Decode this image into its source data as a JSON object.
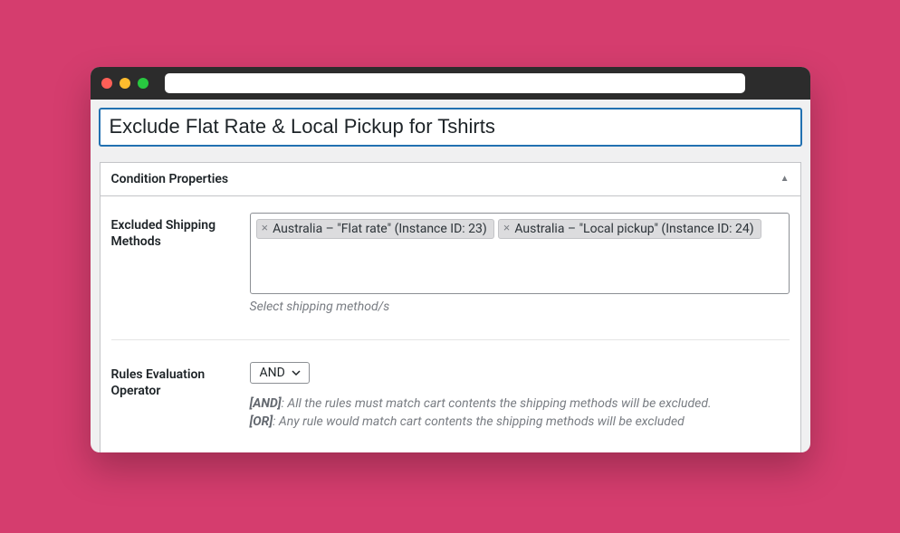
{
  "title_value": "Exclude Flat Rate & Local Pickup for Tshirts",
  "panel": {
    "header": "Condition Properties"
  },
  "excluded": {
    "label": "Excluded Shipping Methods",
    "tags": [
      "Australia – \"Flat rate\" (Instance ID: 23)",
      "Australia – \"Local pickup\" (Instance ID: 24)"
    ],
    "hint": "Select shipping method/s"
  },
  "operator": {
    "label": "Rules Evaluation Operator",
    "value": "AND",
    "desc_and_prefix": "[AND]",
    "desc_and_rest": ": All the rules must match cart contents the shipping methods will be excluded.",
    "desc_or_prefix": "[OR]",
    "desc_or_rest": ": Any rule would match cart contents the shipping methods will be excluded"
  }
}
